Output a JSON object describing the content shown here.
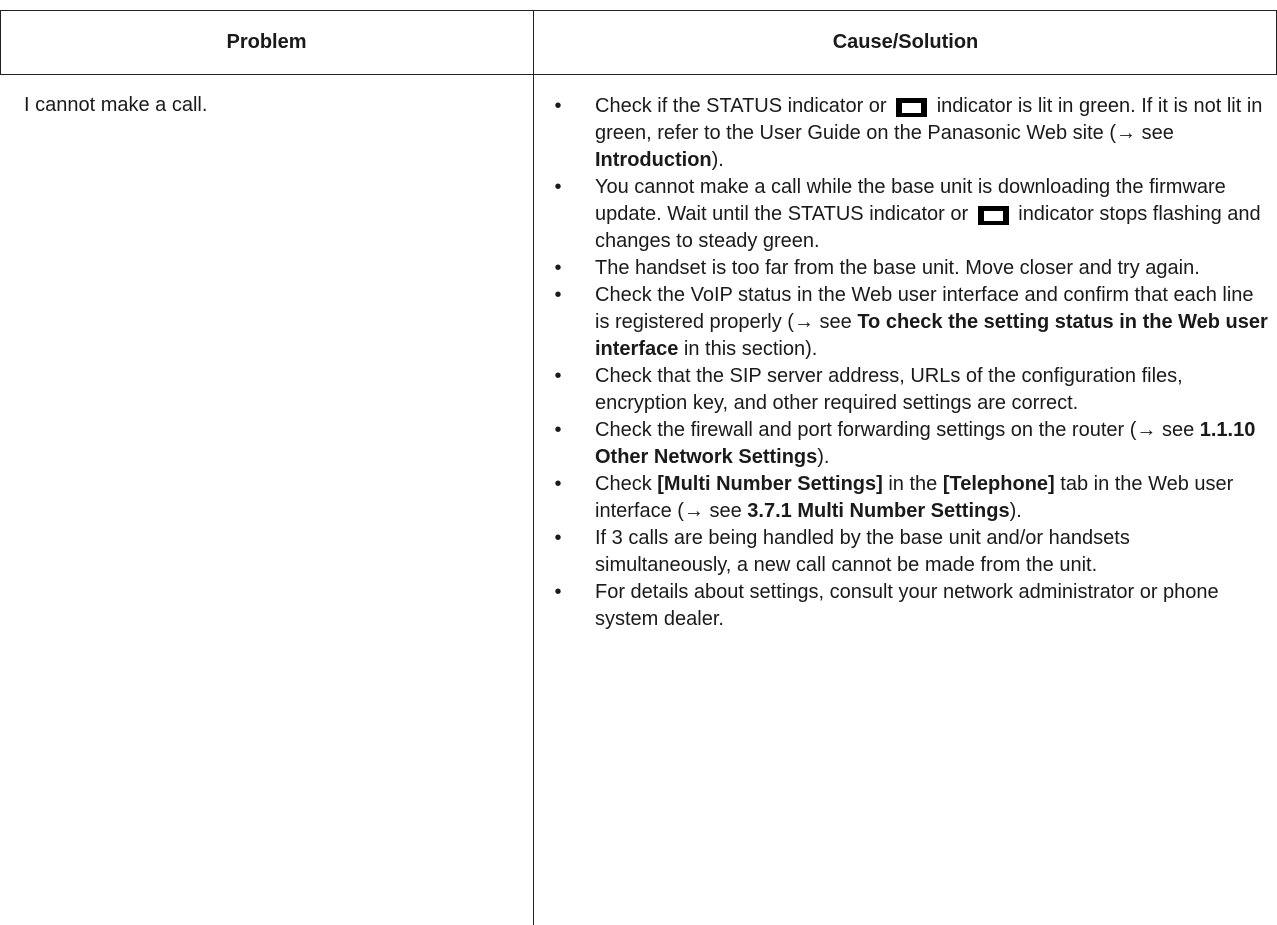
{
  "table": {
    "header": {
      "problem": "Problem",
      "solution": "Cause/Solution"
    },
    "row": {
      "problem": "I cannot make a call.",
      "items": [
        {
          "bullet": "•",
          "parts": [
            "Check if the STATUS indicator or ",
            {
              "icon": "phone-line-icon"
            },
            " indicator is lit in green. If it is not lit in green, refer to the User Guide on the Panasonic Web site (→ see ",
            {
              "b": "Introduction"
            },
            ")."
          ]
        },
        {
          "bullet": "•",
          "parts": [
            "You cannot make a call while the base unit is downloading the firmware update. Wait until the STATUS indicator or ",
            {
              "icon": "phone-line-icon"
            },
            " indicator stops flashing and changes to steady green."
          ]
        },
        {
          "bullet": "•",
          "parts": [
            "The handset is too far from the base unit. Move closer and try again."
          ]
        },
        {
          "bullet": "•",
          "parts": [
            "Check the VoIP status in the Web user interface and confirm that each line is registered properly (→ see ",
            {
              "b": "To check the setting status in the Web user interface"
            },
            " in this section)."
          ]
        },
        {
          "bullet": "•",
          "parts": [
            "Check that the SIP server address, URLs of the configuration files, encryption key, and other required settings are correct."
          ]
        },
        {
          "bullet": "•",
          "parts": [
            "Check the firewall and port forwarding settings on the router (→ see ",
            {
              "b": "1.1.10  Other Network Settings"
            },
            ")."
          ]
        },
        {
          "bullet": "•",
          "parts": [
            "Check ",
            {
              "b": "[Multi Number Settings]"
            },
            " in the ",
            {
              "b": "[Telephone]"
            },
            " tab in the Web user interface (→ see ",
            {
              "b": "3.7.1  Multi Number Settings"
            },
            ")."
          ]
        },
        {
          "bullet": "•",
          "parts": [
            "If 3 calls are being handled by the base unit and/or handsets simultaneously, a new call cannot be made from the unit."
          ]
        },
        {
          "bullet": "•",
          "parts": [
            "For details about settings, consult your network administrator or phone system dealer."
          ]
        }
      ]
    }
  }
}
